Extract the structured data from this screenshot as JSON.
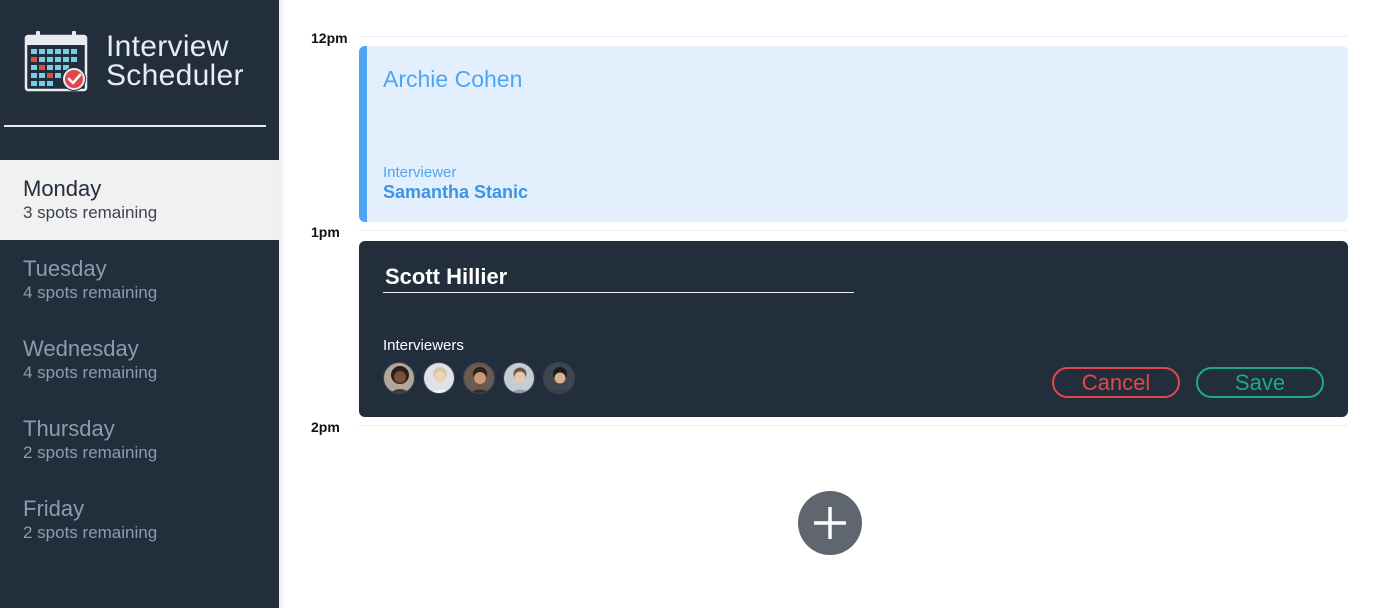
{
  "app": {
    "title_line1": "Interview",
    "title_line2": "Scheduler"
  },
  "days": [
    {
      "name": "Monday",
      "spots": "3 spots remaining",
      "active": true
    },
    {
      "name": "Tuesday",
      "spots": "4 spots remaining",
      "active": false
    },
    {
      "name": "Wednesday",
      "spots": "4 spots remaining",
      "active": false
    },
    {
      "name": "Thursday",
      "spots": "2 spots remaining",
      "active": false
    },
    {
      "name": "Friday",
      "spots": "2 spots remaining",
      "active": false
    }
  ],
  "hours": [
    "12pm",
    "1pm",
    "2pm"
  ],
  "appointments": [
    {
      "student": "Archie Cohen",
      "interviewer_label": "Interviewer",
      "interviewer": "Samantha Stanic"
    }
  ],
  "edit_form": {
    "student_value": "Scott Hillier",
    "interviewers_label": "Interviewers",
    "interviewers": [
      {
        "icon": "interviewer-avatar-1"
      },
      {
        "icon": "interviewer-avatar-2"
      },
      {
        "icon": "interviewer-avatar-3"
      },
      {
        "icon": "interviewer-avatar-4"
      },
      {
        "icon": "interviewer-avatar-5"
      }
    ],
    "cancel_label": "Cancel",
    "save_label": "Save"
  },
  "icons": {
    "logo": "calendar-check-icon",
    "add": "plus-icon"
  },
  "colors": {
    "sidebar": "#222e3c",
    "accent_blue": "#4ea5f5",
    "appointment_bg": "#e3effd",
    "danger": "#e2474b",
    "success": "#1ea88a",
    "add_button": "#5f6670"
  }
}
